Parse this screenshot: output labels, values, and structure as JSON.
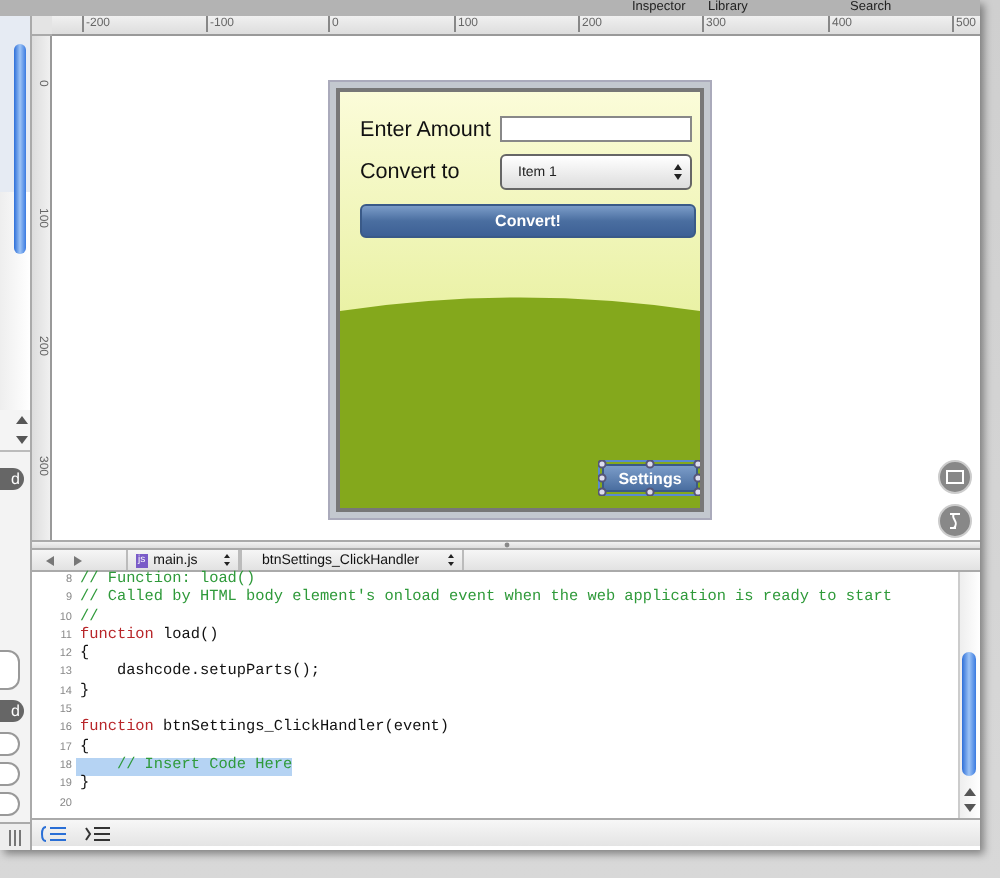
{
  "toolbar": {
    "labels": [
      "Inspector",
      "Library",
      "Search"
    ]
  },
  "rulers": {
    "horizontal": [
      "-200",
      "-100",
      "0",
      "100",
      "200",
      "300",
      "400",
      "500"
    ],
    "vertical": [
      "0",
      "100",
      "200",
      "300"
    ]
  },
  "sidebar": {
    "badges": [
      "d",
      "d"
    ]
  },
  "canvas": {
    "amount_label": "Enter Amount",
    "convert_label": "Convert to",
    "select_value": "Item 1",
    "convert_button": "Convert!",
    "settings_button": {
      "label": "Settings",
      "selected": true
    }
  },
  "editor": {
    "file": "main.js",
    "file_badge": "js",
    "function": "btnSettings_ClickHandler",
    "lines": [
      {
        "number": "8",
        "selected": false,
        "tokens": [
          {
            "kind": "comment",
            "text": "// Function: load()"
          }
        ]
      },
      {
        "number": "9",
        "selected": false,
        "tokens": [
          {
            "kind": "comment",
            "text": "// Called by HTML body element's onload event when the web application is ready to start"
          }
        ]
      },
      {
        "number": "10",
        "selected": false,
        "tokens": [
          {
            "kind": "comment",
            "text": "//"
          }
        ]
      },
      {
        "number": "11",
        "selected": false,
        "tokens": [
          {
            "kind": "keyword",
            "text": "function"
          },
          {
            "kind": "plain",
            "text": " load()"
          }
        ]
      },
      {
        "number": "12",
        "selected": false,
        "tokens": [
          {
            "kind": "plain",
            "text": "{"
          }
        ]
      },
      {
        "number": "13",
        "selected": false,
        "tokens": [
          {
            "kind": "plain",
            "text": "    dashcode.setupParts();"
          }
        ]
      },
      {
        "number": "14",
        "selected": false,
        "tokens": [
          {
            "kind": "plain",
            "text": "}"
          }
        ]
      },
      {
        "number": "15",
        "selected": false
      },
      {
        "number": "16",
        "selected": false,
        "tokens": [
          {
            "kind": "keyword",
            "text": "function"
          },
          {
            "kind": "plain",
            "text": " btnSettings_ClickHandler(event)"
          }
        ]
      },
      {
        "number": "17",
        "selected": false,
        "tokens": [
          {
            "kind": "plain",
            "text": "{"
          }
        ]
      },
      {
        "number": "18",
        "selected": true,
        "tokens": [
          {
            "kind": "comment",
            "text": "    // Insert Code Here"
          }
        ]
      },
      {
        "number": "19",
        "selected": false,
        "tokens": [
          {
            "kind": "plain",
            "text": "}"
          }
        ]
      },
      {
        "number": "20",
        "selected": false
      }
    ]
  }
}
